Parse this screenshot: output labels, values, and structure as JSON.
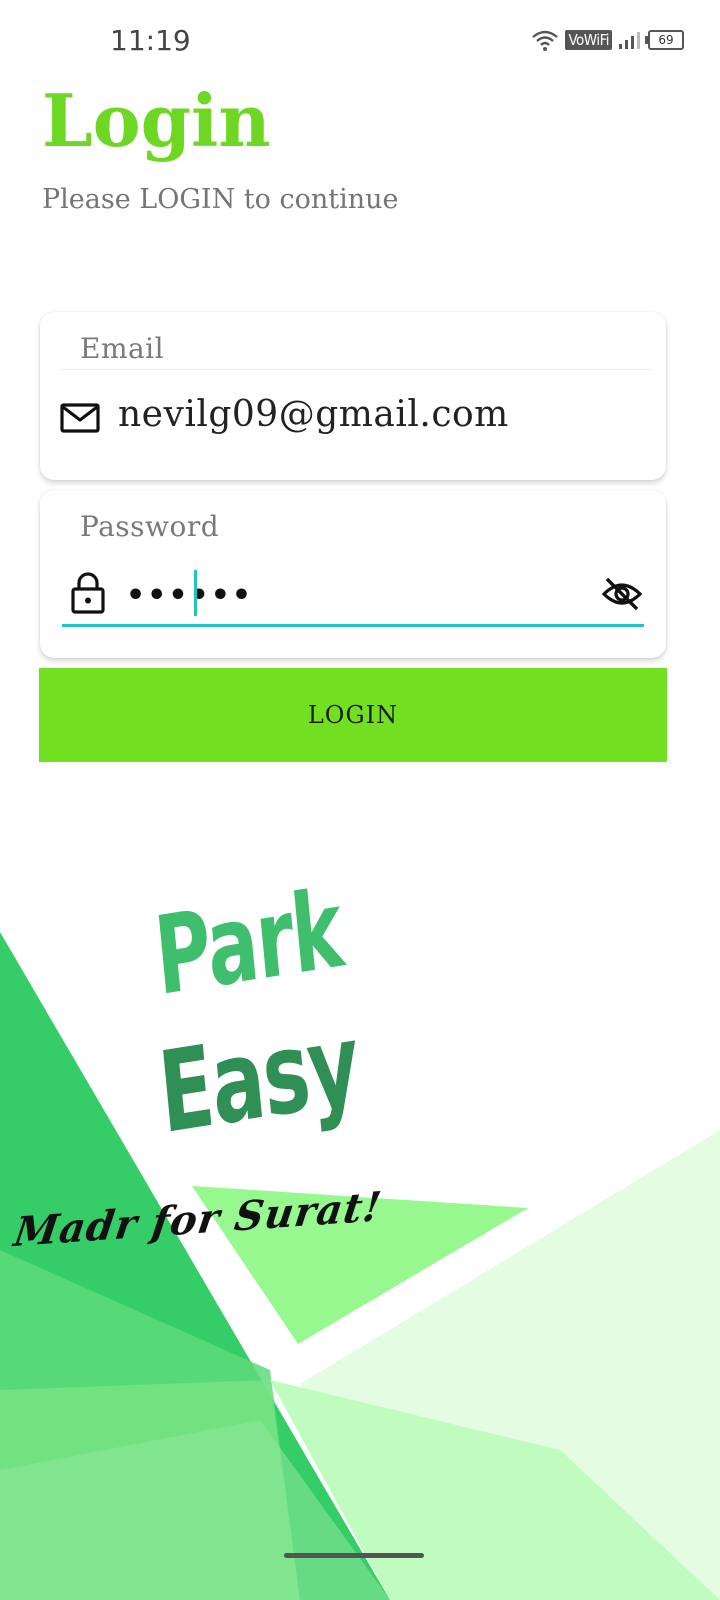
{
  "status_bar": {
    "time": "11:19",
    "network_badge": "VoWiFi",
    "battery_level": "69"
  },
  "header": {
    "title": "Login",
    "subtitle": "Please LOGIN to continue"
  },
  "form": {
    "email": {
      "label": "Email",
      "value": "nevilg09@gmail.com",
      "icon": "mail-icon"
    },
    "password": {
      "label": "Password",
      "value": "••••••",
      "icon": "lock-icon",
      "toggle_icon": "eye-off-icon"
    },
    "login_button": "LOGIN"
  },
  "branding": {
    "logo_line1": "Park",
    "logo_line2": "Easy",
    "tagline": "Madr for Surat!"
  },
  "colors": {
    "accent": "#72df21",
    "title": "#6ed723",
    "focus": "#20c4c0"
  }
}
